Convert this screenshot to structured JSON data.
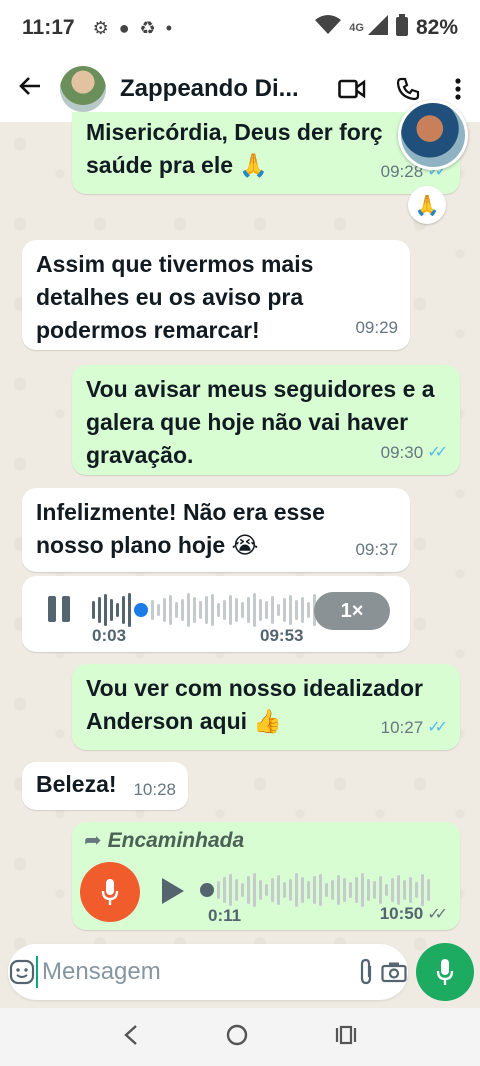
{
  "status_bar": {
    "time": "11:17",
    "network": "4G",
    "battery": "82%"
  },
  "header": {
    "title": "Zappeando Di...",
    "back_icon": "arrow-left-icon",
    "video_icon": "video-call-icon",
    "call_icon": "phone-icon",
    "menu_icon": "more-vert-icon"
  },
  "messages": [
    {
      "type": "out",
      "text_line1": "Misericórdia, Deus der forç",
      "text_line2": "saúde pra ele 🙏",
      "time": "09:28",
      "ticks": "✓✓",
      "reaction": "🙏"
    },
    {
      "type": "in",
      "text": "Assim que tivermos mais detalhes eu os aviso pra podermos remarcar!",
      "time": "09:29"
    },
    {
      "type": "out",
      "text": "Vou avisar meus seguidores e a galera que hoje não vai haver gravação.",
      "time": "09:30",
      "ticks": "✓✓"
    },
    {
      "type": "in",
      "text": "Infelizmente! Não era esse nosso plano hoje 😭",
      "time": "09:37"
    },
    {
      "type": "in-audio",
      "position": "0:03",
      "duration": "09:53",
      "speed": "1×",
      "progress": 0.2
    },
    {
      "type": "out",
      "text": "Vou ver com nosso idealizador Anderson aqui 👍",
      "time": "10:27",
      "ticks": "✓✓"
    },
    {
      "type": "in",
      "text": "Beleza!",
      "time": "10:28"
    },
    {
      "type": "out-audio",
      "forwarded_label": "Encaminhada",
      "position": "0:11",
      "time": "10:50",
      "ticks": "✓✓"
    }
  ],
  "input": {
    "placeholder": "Mensagem"
  },
  "colors": {
    "out_bubble": "#d9fdd3",
    "in_bubble": "#ffffff",
    "accent": "#1daa61",
    "tick_read": "#53bdeb"
  }
}
